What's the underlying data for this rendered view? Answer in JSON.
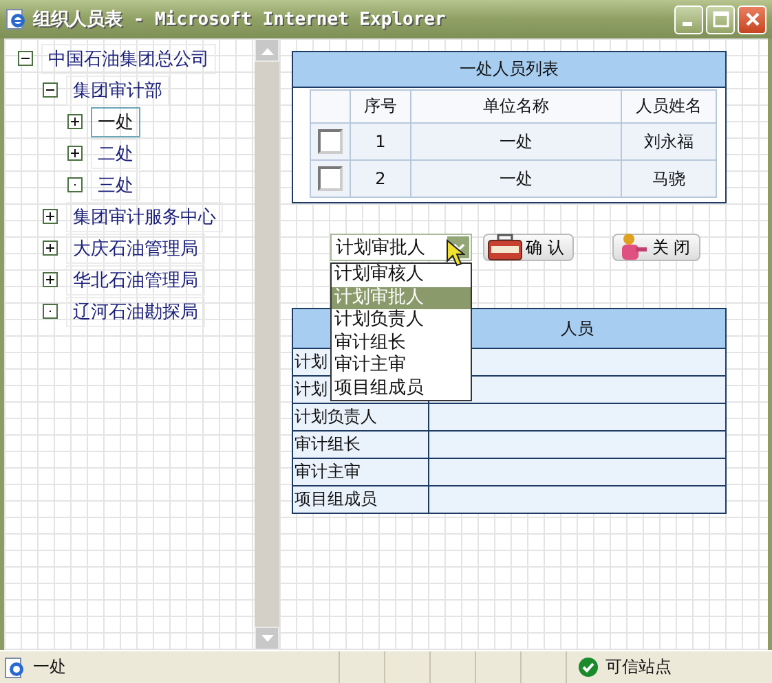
{
  "window": {
    "title": "组织人员表 - Microsoft Internet Explorer"
  },
  "tree": [
    {
      "label": "中国石油集团总公司",
      "kind": "branch",
      "expanded": true,
      "selected": false,
      "children": [
        {
          "label": "集团审计部",
          "kind": "branch",
          "expanded": true,
          "selected": false,
          "children": [
            {
              "label": "一处",
              "kind": "branch",
              "expanded": false,
              "selected": true
            },
            {
              "label": "二处",
              "kind": "branch",
              "expanded": false,
              "selected": false
            },
            {
              "label": "三处",
              "kind": "leaf",
              "selected": false
            }
          ]
        },
        {
          "label": "集团审计服务中心",
          "kind": "branch",
          "expanded": false,
          "selected": false
        },
        {
          "label": "大庆石油管理局",
          "kind": "branch",
          "expanded": false,
          "selected": false
        },
        {
          "label": "华北石油管理局",
          "kind": "branch",
          "expanded": false,
          "selected": false
        },
        {
          "label": "辽河石油勘探局",
          "kind": "leaf",
          "selected": false
        }
      ]
    }
  ],
  "people_table": {
    "caption": "一处人员列表",
    "columns": [
      "序号",
      "单位名称",
      "人员姓名"
    ],
    "rows": [
      {
        "checked": false,
        "cells": [
          "1",
          "一处",
          "刘永福"
        ]
      },
      {
        "checked": false,
        "cells": [
          "2",
          "一处",
          "马骁"
        ]
      }
    ]
  },
  "role_select": {
    "value": "计划审批人",
    "open": true,
    "options": [
      {
        "label": "计划审核人",
        "selected": false
      },
      {
        "label": "计划审批人",
        "selected": true
      },
      {
        "label": "计划负责人",
        "selected": false
      },
      {
        "label": "审计组长",
        "selected": false
      },
      {
        "label": "审计主审",
        "selected": false
      },
      {
        "label": "项目组成员",
        "selected": false
      }
    ]
  },
  "buttons": [
    {
      "kind": "confirm",
      "label": "确 认"
    },
    {
      "kind": "close",
      "label": "关 闭"
    }
  ],
  "role_table": {
    "columns": [
      "人员"
    ],
    "roles": [
      "计划",
      "计划",
      "计划负责人",
      "审计组长",
      "审计主审",
      "项目组成员"
    ]
  },
  "status_bar": {
    "text": "一处",
    "zone": "可信站点"
  }
}
